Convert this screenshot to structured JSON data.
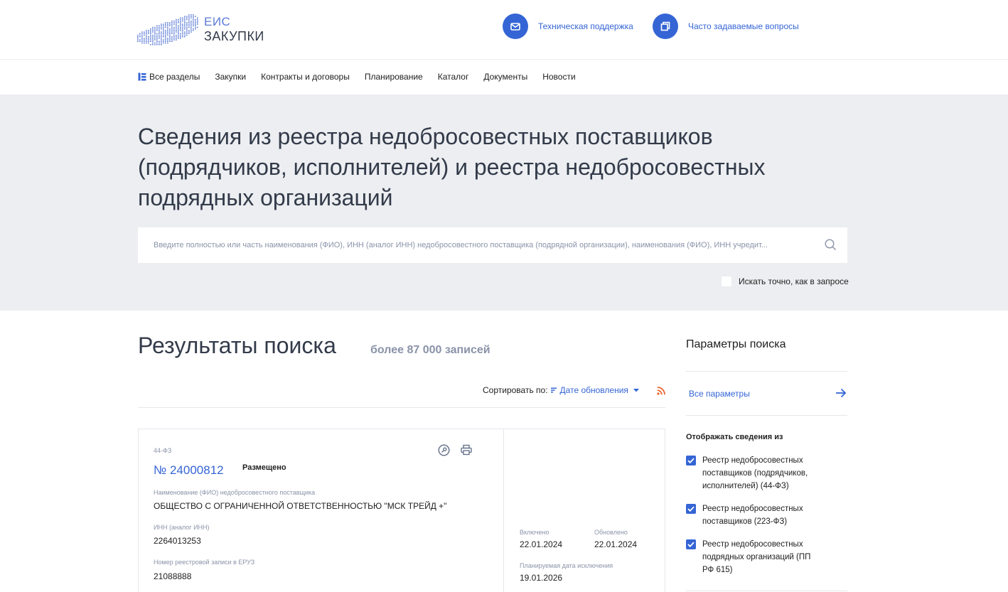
{
  "header": {
    "logo_line1": "ЕИС",
    "logo_line2": "ЗАКУПКИ",
    "support_label": "Техническая поддержка",
    "faq_label": "Часто задаваемые вопросы"
  },
  "nav": {
    "items": [
      {
        "label": "Все разделы"
      },
      {
        "label": "Закупки"
      },
      {
        "label": "Контракты и договоры"
      },
      {
        "label": "Планирование"
      },
      {
        "label": "Каталог"
      },
      {
        "label": "Документы"
      },
      {
        "label": "Новости"
      }
    ]
  },
  "hero": {
    "title": "Сведения из реестра недобросовестных поставщиков (подрядчиков, исполнителей) и реестра недобросовестных подрядных организаций",
    "search_placeholder": "Введите полностью или часть наименования (ФИО), ИНН (аналог ИНН) недобросовестного поставщика (подрядной организации), наименования (ФИО), ИНН учредит...",
    "exact_label": "Искать точно, как в запросе",
    "exact_checked": false
  },
  "results": {
    "title": "Результаты поиска",
    "count": "более 87 000 записей",
    "sort_label": "Сортировать по:",
    "sort_value": "Дате обновления"
  },
  "card": {
    "law": "44-ФЗ",
    "number": "№ 24000812",
    "status": "Размещено",
    "name_label": "Наименование (ФИО) недобросовестного поставщика",
    "name_value": "ОБЩЕСТВО С ОГРАНИЧЕННОЙ ОТВЕТСТВЕННОСТЬЮ \"МСК ТРЕЙД +\"",
    "inn_label": "ИНН (аналог ИНН)",
    "inn_value": "2264013253",
    "eruz_label": "Номер реестровой записи в ЕРУЗ",
    "eruz_value": "21088888",
    "included_label": "Включено",
    "included_value": "22.01.2024",
    "updated_label": "Обновлено",
    "updated_value": "22.01.2024",
    "planned_label": "Планируемая дата исключения",
    "planned_value": "19.01.2026"
  },
  "sidebar": {
    "title": "Параметры поиска",
    "all_params": "Все параметры",
    "display_title": "Отображать сведения из",
    "options": [
      {
        "label": "Реестр недобросовестных поставщиков (подрядчиков, исполнителей) (44-ФЗ)",
        "checked": true
      },
      {
        "label": "Реестр недобросовестных поставщиков (223-ФЗ)",
        "checked": true
      },
      {
        "label": "Реестр недобросовестных подрядных организаций (ПП РФ 615)",
        "checked": true
      }
    ]
  },
  "colors": {
    "accent": "#3565d5",
    "hero_bg": "#eceef1",
    "muted": "#8a93a8",
    "rss": "#e8622c"
  }
}
